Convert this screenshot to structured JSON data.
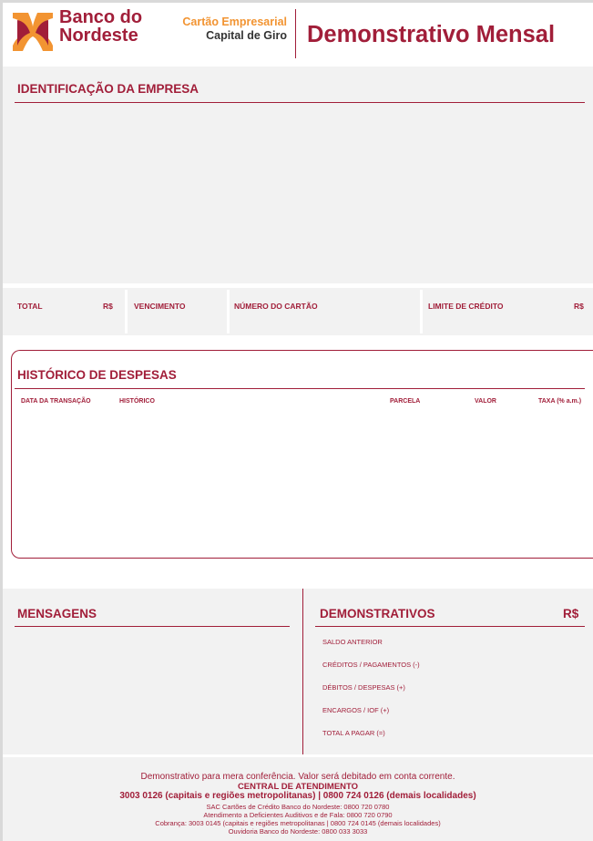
{
  "header": {
    "logo_line1": "Banco do",
    "logo_line2": "Nordeste",
    "product_line1": "Cartão Empresarial",
    "product_line2": "Capital de Giro",
    "title": "Demonstrativo Mensal"
  },
  "identificacao": {
    "title": "IDENTIFICAÇÃO DA EMPRESA"
  },
  "summary": {
    "total": "TOTAL",
    "total_currency": "R$",
    "vencimento": "VENCIMENTO",
    "numero_cartao": "NÚMERO DO CARTÃO",
    "limite": "LIMITE DE CRÉDITO",
    "limite_currency": "R$"
  },
  "historico": {
    "title": "HISTÓRICO DE DESPESAS",
    "columns": [
      "DATA DA TRANSAÇÃO",
      "HISTÓRICO",
      "PARCELA",
      "VALOR",
      "TAXA (% a.m.)"
    ]
  },
  "mensagens": {
    "title": "MENSAGENS"
  },
  "demonstrativos": {
    "title": "DEMONSTRATIVOS",
    "currency": "R$",
    "items": [
      "SALDO ANTERIOR",
      "CRÉDITOS / PAGAMENTOS (-)",
      "DÉBITOS / DESPESAS (+)",
      "ENCARGOS / IOF (+)",
      "TOTAL A PAGAR  (=)"
    ]
  },
  "footer": {
    "line1": "Demonstrativo para mera conferência. Valor será debitado em conta corrente.",
    "line2": "CENTRAL DE ATENDIMENTO",
    "line3": "3003 0126 (capitais e regiões metropolitanas) | 0800 724 0126 (demais localidades)",
    "line4": "SAC Cartões de Crédito Banco do Nordeste: 0800 720 0780",
    "line5": "Atendimento a Deficientes Auditivos e de Fala: 0800 720 0790",
    "line6": "Cobrança: 3003 0145 (capitais e regiões metropolitanas | 0800 724 0145 (demais localidades)",
    "line7": "Ouvidoria Banco do Nordeste: 0800 033 3033"
  },
  "colors": {
    "brand": "#a11e39",
    "accent": "#f29432",
    "panel": "#f2f2f2"
  }
}
